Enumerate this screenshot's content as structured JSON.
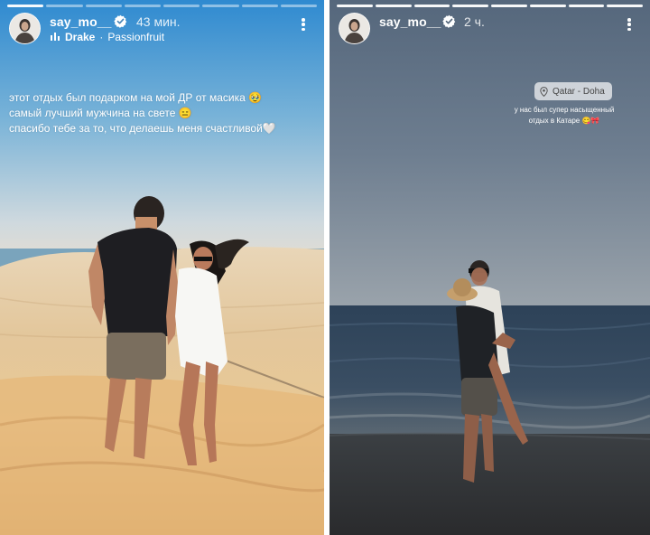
{
  "story_left": {
    "username": "say_mo__",
    "time": "43 мин.",
    "music_artist": "Drake",
    "music_separator": "·",
    "music_title": "Passionfruit",
    "caption_lines": [
      "этот отдых был подарком на мой ДР от масика 🥹",
      "самый лучший мужчина на свете 😑",
      "спасибо тебе за то, что делаешь меня счастливой🤍"
    ],
    "progress_segments_total": 8,
    "progress_segments_done": 1
  },
  "story_right": {
    "username": "say_mo__",
    "time": "2 ч.",
    "location_sticker": "Qatar - Doha",
    "caption_lines": [
      "у нас был супер насыщенный",
      "отдых в Катаре 😋🎀"
    ],
    "progress_segments_total": 8,
    "progress_segments_done": 8
  },
  "icons": {
    "verified": "verified-badge-icon",
    "music": "music-bars-icon",
    "more": "more-vertical-icon",
    "location": "location-pin-icon"
  },
  "colors": {
    "verified_blue": "#3897f0",
    "left_sky_top": "#2f8ad0",
    "left_sand": "#e9c894",
    "right_sky_top": "#55677c",
    "right_sea": "#2a3f57"
  }
}
